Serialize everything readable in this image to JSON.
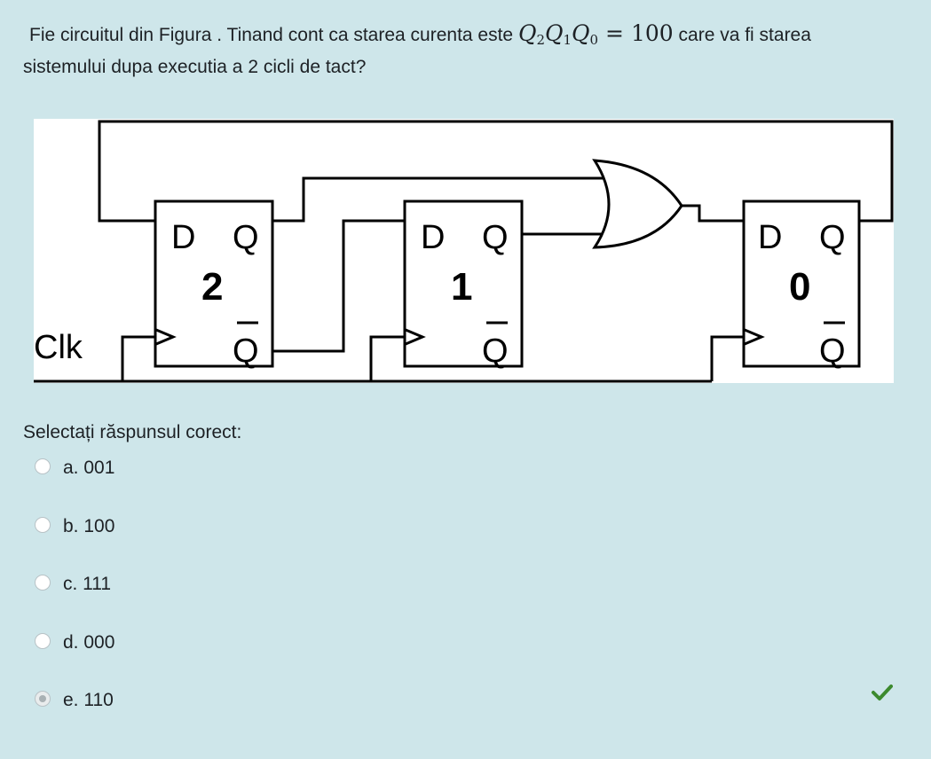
{
  "question": {
    "text_before": "Fie circuitul din Figura . Tinand cont ca starea curenta este",
    "math_state": "Q2Q1Q0 = 100",
    "text_after": "care va fi starea",
    "text_line2": "sistemului dupa executia a 2 cicli de tact?"
  },
  "figure": {
    "clock_label": "Clk",
    "flipflops": [
      {
        "number": "2",
        "d_label": "D",
        "q_label": "Q",
        "qbar_label": "Q"
      },
      {
        "number": "1",
        "d_label": "D",
        "q_label": "Q",
        "qbar_label": "Q"
      },
      {
        "number": "0",
        "d_label": "D",
        "q_label": "Q",
        "qbar_label": "Q"
      }
    ]
  },
  "prompt": "Selectați răspunsul corect:",
  "answers": [
    {
      "label": "a. 001",
      "selected": false
    },
    {
      "label": "b. 100",
      "selected": false
    },
    {
      "label": "c. 111",
      "selected": false
    },
    {
      "label": "d. 000",
      "selected": false
    },
    {
      "label": "e.  110",
      "selected": true
    }
  ],
  "feedback": {
    "icon": "check-icon",
    "color": "#3c8a2e"
  }
}
